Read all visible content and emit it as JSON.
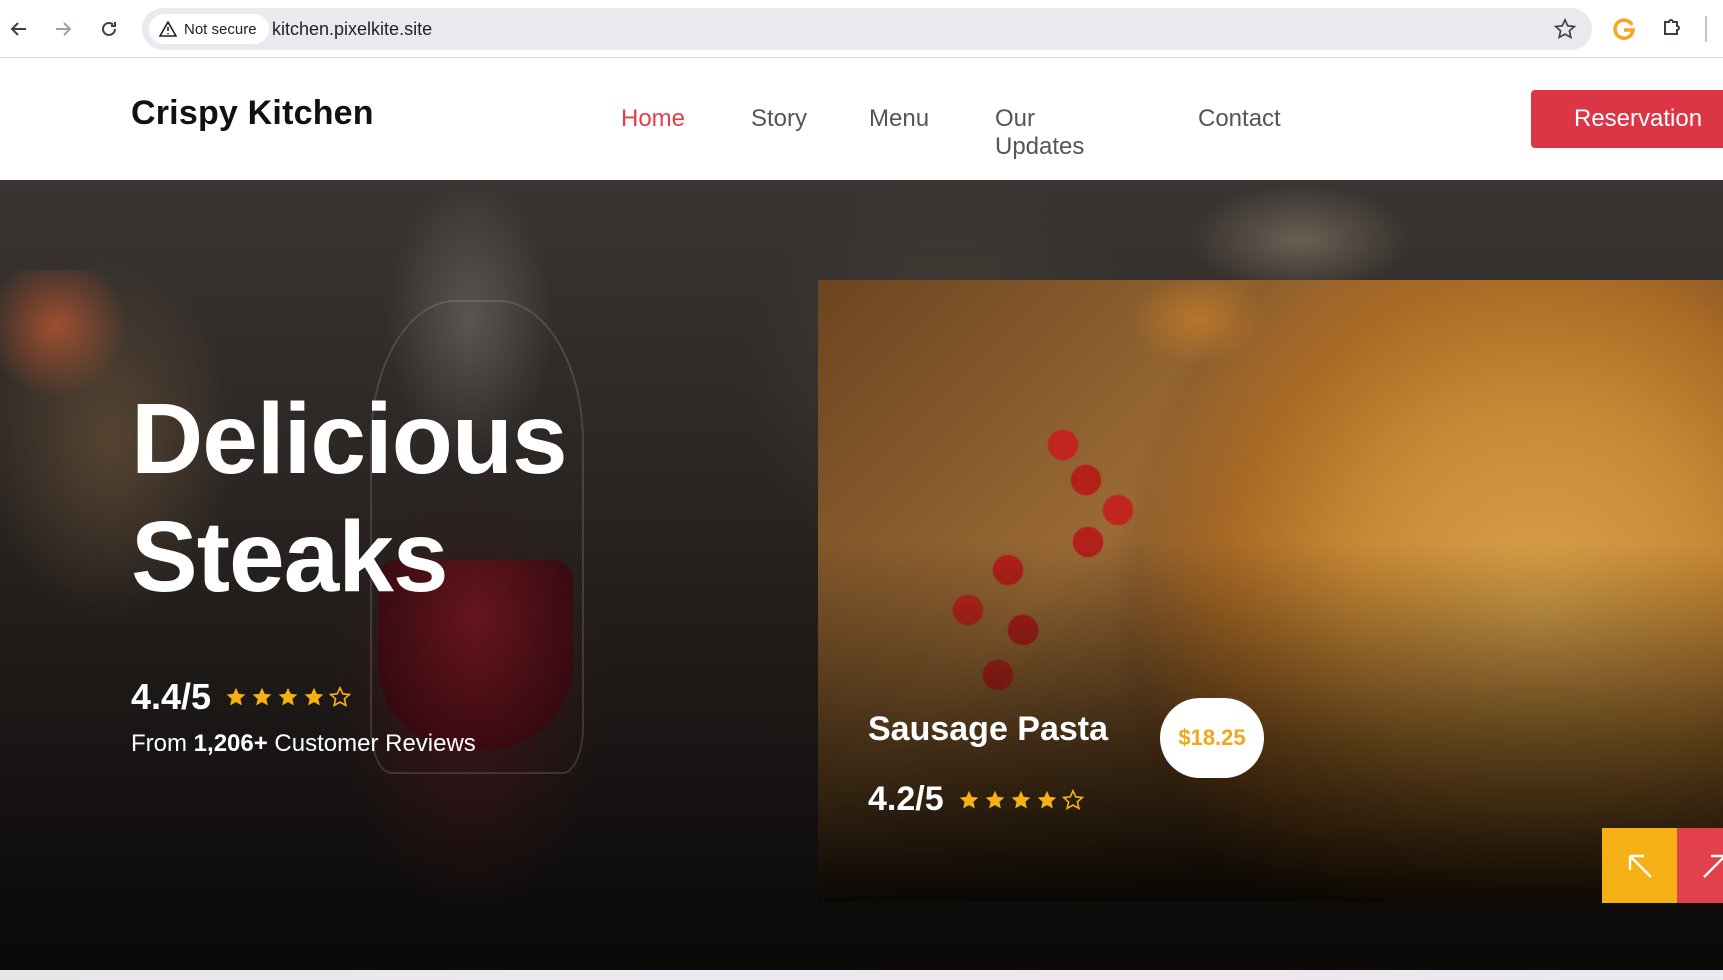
{
  "browser": {
    "back_icon": "arrow-left-icon",
    "forward_icon": "arrow-right-icon",
    "reload_icon": "reload-icon",
    "security_label": "Not secure",
    "url": "kitchen.pixelkite.site",
    "bookmark_icon": "star-outline-icon",
    "extension_icons": [
      "g-extension-icon",
      "puzzle-icon"
    ]
  },
  "site": {
    "logo": "Crispy Kitchen",
    "nav": [
      {
        "label": "Home",
        "active": true
      },
      {
        "label": "Story",
        "active": false
      },
      {
        "label": "Menu",
        "active": false
      },
      {
        "label": "Our Updates",
        "active": false
      },
      {
        "label": "Contact",
        "active": false
      }
    ],
    "cta_label": "Reservation"
  },
  "hero": {
    "title_line1": "Delicious",
    "title_line2": "Steaks",
    "rating": "4.4/5",
    "stars": 4,
    "stars_max": 5,
    "reviews_prefix": "From",
    "reviews_count": "1,206+",
    "reviews_suffix": "Customer Reviews"
  },
  "featured": {
    "name": "Sausage Pasta",
    "price": "$18.25",
    "rating": "4.2/5",
    "stars": 4,
    "stars_max": 5,
    "prev_icon": "arrow-up-left-icon",
    "next_icon": "arrow-up-right-icon"
  },
  "colors": {
    "accent_red": "#dc3545",
    "nav_active": "#e0404d",
    "star_gold": "#f5b014",
    "price_text": "#f0a81a"
  }
}
